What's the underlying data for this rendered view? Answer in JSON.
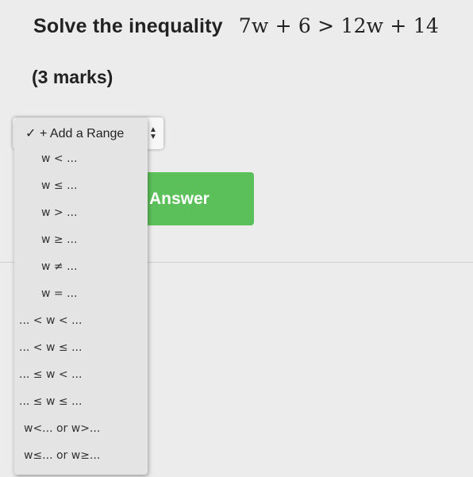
{
  "question": {
    "prefix": "Solve the inequality",
    "math": "7w + 6 > 12w + 14",
    "marks": "(3 marks)"
  },
  "answer_button": {
    "label": "Answer"
  },
  "range_select": {
    "selected": "+ Add a Range",
    "check_icon": "✓",
    "options": [
      "w < ...",
      "w ≤ ...",
      "w > ...",
      "w ≥ ...",
      "w ≠ ...",
      "w = ...",
      "... < w < ...",
      "... < w ≤ ...",
      "... ≤ w < ...",
      "... ≤ w ≤ ...",
      "w<... or w>...",
      "w≤... or w≥..."
    ]
  },
  "icons": {
    "check": "check-icon",
    "select_arrows": "select-arrows-icon"
  },
  "colors": {
    "answer_button": "#5cc05a",
    "background": "#ececec"
  }
}
